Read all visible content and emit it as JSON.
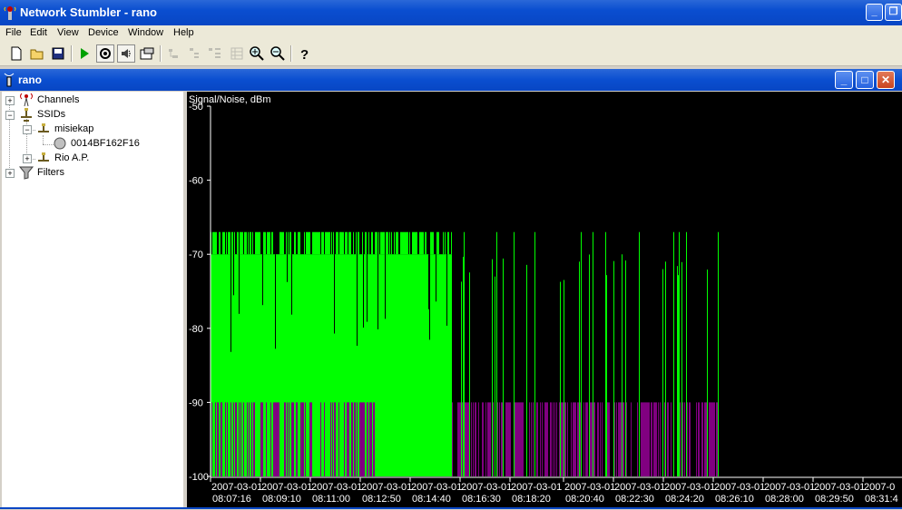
{
  "window": {
    "title": "Network Stumbler - rano"
  },
  "menu": [
    "File",
    "Edit",
    "View",
    "Device",
    "Window",
    "Help"
  ],
  "toolbar_icons": [
    "new-icon",
    "open-icon",
    "save-icon",
    "play-icon",
    "scan-options-icon",
    "sound-icon",
    "properties-icon",
    "tree-view-icon-1",
    "tree-view-icon-2",
    "tree-view-icon-3",
    "list-view-icon",
    "zoom-in-icon",
    "zoom-out-icon",
    "help-icon"
  ],
  "child": {
    "title": "rano"
  },
  "tree": {
    "channels": "Channels",
    "ssids": "SSIDs",
    "ssid1": "misiekap",
    "mac1": "0014BF162F16",
    "ssid2": "Rio A.P.",
    "filters": "Filters"
  },
  "colors": {
    "signal": "#00ff00",
    "noise": "#800080",
    "background": "#000000"
  },
  "chart_data": {
    "type": "bar",
    "ylabel": "Signal/Noise, dBm",
    "ylim": [
      -100,
      -50
    ],
    "yticks": [
      -50,
      -60,
      -70,
      -80,
      -90,
      -100
    ],
    "xticks": [
      {
        "date": "2007-03-01",
        "time": "08:07:16"
      },
      {
        "date": "2007-03-01",
        "time": "08:09:10"
      },
      {
        "date": "2007-03-01",
        "time": "08:11:00"
      },
      {
        "date": "2007-03-01",
        "time": "08:12:50"
      },
      {
        "date": "2007-03-01",
        "time": "08:14:40"
      },
      {
        "date": "2007-03-01",
        "time": "08:16:30"
      },
      {
        "date": "2007-03-01",
        "time": "08:18:20"
      },
      {
        "date": "2007-03-01",
        "time": "08:20:40"
      },
      {
        "date": "2007-03-01",
        "time": "08:22:30"
      },
      {
        "date": "2007-03-01",
        "time": "08:24:20"
      },
      {
        "date": "2007-03-01",
        "time": "08:26:10"
      },
      {
        "date": "2007-03-01",
        "time": "08:28:00"
      },
      {
        "date": "2007-03-01",
        "time": "08:29:50"
      },
      {
        "date": "2007-0",
        "time": "08:31:4"
      }
    ],
    "series": [
      {
        "name": "signal",
        "typical_top": -70,
        "max": -67,
        "min": -100
      },
      {
        "name": "noise",
        "top": -90,
        "min": -100
      }
    ],
    "segments": [
      {
        "from": "08:07:16",
        "to": "08:15:30",
        "signal_top": -70,
        "signal_peak": -67,
        "density": "solid"
      },
      {
        "from": "08:15:30",
        "to": "08:25:10",
        "signal_peak": -67,
        "density": "sparse"
      }
    ]
  }
}
